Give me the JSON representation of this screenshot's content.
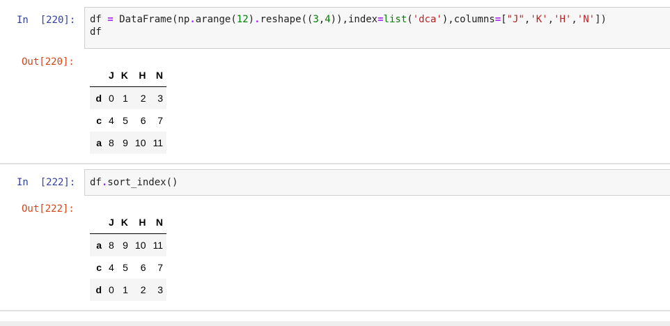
{
  "cells": [
    {
      "in_prompt": "In  [220]:",
      "code_tokens": [
        {
          "t": "df ",
          "c": ""
        },
        {
          "t": "=",
          "c": "op"
        },
        {
          "t": " DataFrame(np",
          "c": ""
        },
        {
          "t": ".",
          "c": "op"
        },
        {
          "t": "arange(",
          "c": ""
        },
        {
          "t": "12",
          "c": "num"
        },
        {
          "t": ")",
          "c": ""
        },
        {
          "t": ".",
          "c": "op"
        },
        {
          "t": "reshape((",
          "c": ""
        },
        {
          "t": "3",
          "c": "num"
        },
        {
          "t": ",",
          "c": ""
        },
        {
          "t": "4",
          "c": "num"
        },
        {
          "t": ")),index",
          "c": ""
        },
        {
          "t": "=",
          "c": "op"
        },
        {
          "t": "list",
          "c": "builtin"
        },
        {
          "t": "(",
          "c": ""
        },
        {
          "t": "'dca'",
          "c": "str"
        },
        {
          "t": "),columns",
          "c": ""
        },
        {
          "t": "=",
          "c": "op"
        },
        {
          "t": "[",
          "c": ""
        },
        {
          "t": "\"J\"",
          "c": "str"
        },
        {
          "t": ",",
          "c": ""
        },
        {
          "t": "'K'",
          "c": "str"
        },
        {
          "t": ",",
          "c": ""
        },
        {
          "t": "'H'",
          "c": "str"
        },
        {
          "t": ",",
          "c": ""
        },
        {
          "t": "'N'",
          "c": "str"
        },
        {
          "t": "])",
          "c": ""
        }
      ],
      "code_line2": "df",
      "out_prompt": "Out[220]:",
      "table": {
        "columns": [
          "J",
          "K",
          "H",
          "N"
        ],
        "rows": [
          {
            "index": "d",
            "values": [
              "0",
              "1",
              "2",
              "3"
            ]
          },
          {
            "index": "c",
            "values": [
              "4",
              "5",
              "6",
              "7"
            ]
          },
          {
            "index": "a",
            "values": [
              "8",
              "9",
              "10",
              "11"
            ]
          }
        ]
      }
    },
    {
      "in_prompt": "In  [222]:",
      "code_tokens": [
        {
          "t": "df",
          "c": ""
        },
        {
          "t": ".",
          "c": "op"
        },
        {
          "t": "sort_index()",
          "c": ""
        }
      ],
      "code_line2": "",
      "out_prompt": "Out[222]:",
      "table": {
        "columns": [
          "J",
          "K",
          "H",
          "N"
        ],
        "rows": [
          {
            "index": "a",
            "values": [
              "8",
              "9",
              "10",
              "11"
            ]
          },
          {
            "index": "c",
            "values": [
              "4",
              "5",
              "6",
              "7"
            ]
          },
          {
            "index": "d",
            "values": [
              "0",
              "1",
              "2",
              "3"
            ]
          }
        ]
      }
    }
  ]
}
